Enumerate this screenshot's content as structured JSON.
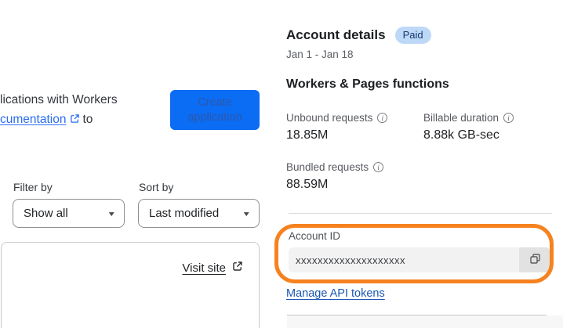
{
  "left": {
    "intro_line1": "lications with Workers",
    "intro_link_text": "cumentation",
    "intro_after_link": "to",
    "create_button_label": "Create application",
    "filter_by_label": "Filter by",
    "filter_value": "Show all",
    "sort_by_label": "Sort by",
    "sort_value": "Last modified",
    "visit_site_label": "Visit site"
  },
  "account": {
    "title": "Account details",
    "plan_badge": "Paid",
    "date_range": "Jan 1 - Jan 18",
    "section_title": "Workers & Pages functions",
    "stats": [
      {
        "label": "Unbound requests",
        "value": "18.85M"
      },
      {
        "label": "Billable duration",
        "value": "8.88k GB-sec"
      },
      {
        "label": "Bundled requests",
        "value": "88.59M"
      }
    ],
    "account_id": {
      "label": "Account ID",
      "value": "xxxxxxxxxxxxxxxxxxxx"
    },
    "manage_api_tokens_label": "Manage API tokens"
  },
  "icons": {
    "info_glyph": "i",
    "caret_down_glyph": "▼"
  },
  "colors": {
    "accent_blue": "#0b6cf4",
    "button_text_muted": "#2d58ab",
    "highlight_orange": "#f6821f",
    "badge_bg": "#bed8f8",
    "badge_text": "#16376b",
    "link_blue": "#2a6df0",
    "link_blue_dark": "#1c57b2"
  }
}
